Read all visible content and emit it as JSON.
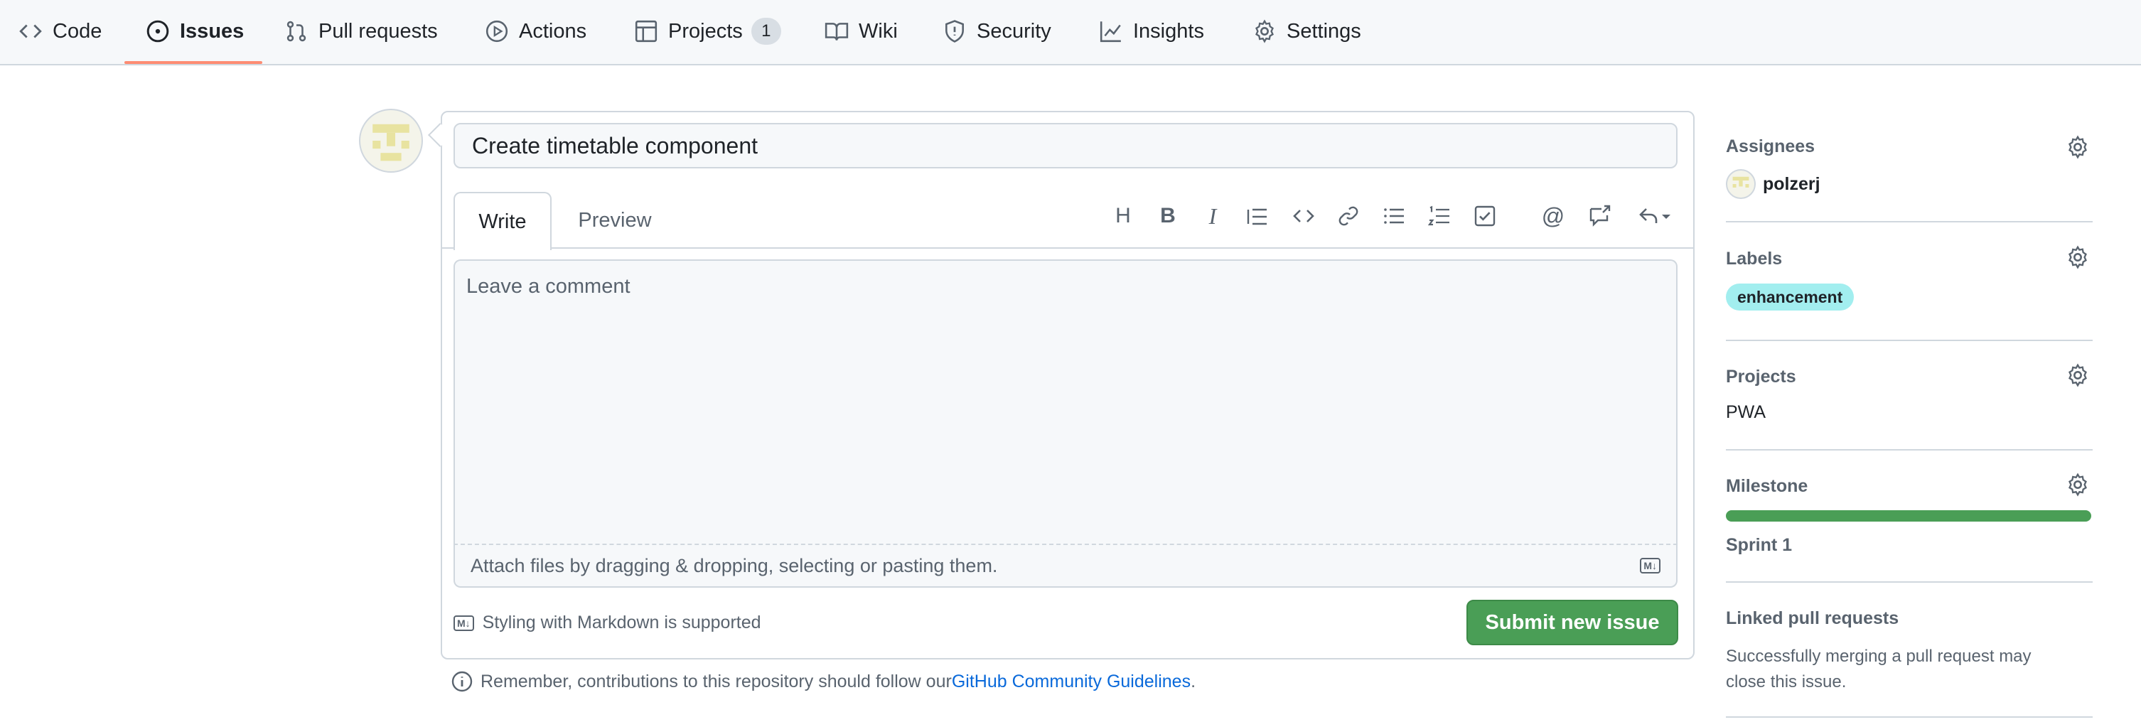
{
  "nav": {
    "tabs": [
      {
        "label": "Code",
        "icon": "code-icon"
      },
      {
        "label": "Issues",
        "icon": "issue-opened-icon"
      },
      {
        "label": "Pull requests",
        "icon": "pull-request-icon"
      },
      {
        "label": "Actions",
        "icon": "play-icon"
      },
      {
        "label": "Projects",
        "icon": "table-icon",
        "counter": "1"
      },
      {
        "label": "Wiki",
        "icon": "book-icon"
      },
      {
        "label": "Security",
        "icon": "shield-icon"
      },
      {
        "label": "Insights",
        "icon": "graph-icon"
      },
      {
        "label": "Settings",
        "icon": "gear-icon"
      }
    ],
    "active": "Issues",
    "active_color": "#fd8c73"
  },
  "issue": {
    "title_value": "Create timetable component",
    "write_tab": "Write",
    "preview_tab": "Preview",
    "comment_placeholder": "Leave a comment",
    "attach_text": "Attach files by dragging & dropping, selecting or pasting them.",
    "markdown_note": "Styling with Markdown is supported",
    "markdown_badge": "M↓",
    "submit_label": "Submit new issue",
    "remember_text": "Remember, contributions to this repository should follow our ",
    "remember_link": "GitHub Community Guidelines",
    "remember_end": ".",
    "toolbar": [
      "heading-icon",
      "bold-icon",
      "italic-icon",
      "quote-icon",
      "code-icon",
      "link-icon",
      "unordered-list-icon",
      "ordered-list-icon",
      "tasklist-icon",
      "mention-icon",
      "reference-icon",
      "reply-icon"
    ],
    "heading_glyph": "H",
    "bold_glyph": "B",
    "italic_glyph": "I",
    "mention_glyph": "@"
  },
  "sidebar": {
    "assignees": {
      "heading": "Assignees",
      "user": "polzerj"
    },
    "labels": {
      "heading": "Labels",
      "label": "enhancement",
      "label_color": "#a2eeef"
    },
    "projects": {
      "heading": "Projects",
      "value": "PWA"
    },
    "milestone": {
      "heading": "Milestone",
      "value": "Sprint 1",
      "progress": 1.0,
      "bar_color": "#4a9e56"
    },
    "linked": {
      "heading": "Linked pull requests",
      "text_line1": "Successfully merging a pull request may",
      "text_line2": "close this issue."
    }
  },
  "colors": {
    "submit": "#4a9e56",
    "link": "#0969da"
  }
}
